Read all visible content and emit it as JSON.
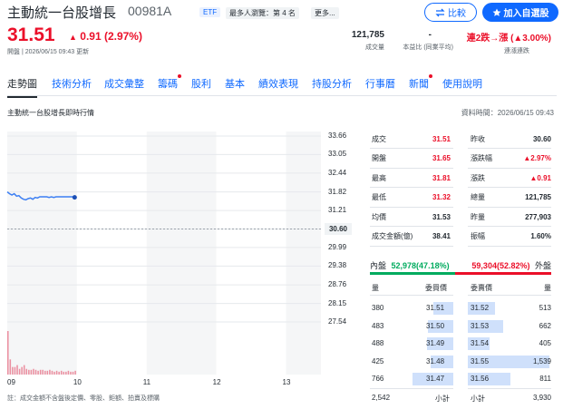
{
  "header": {
    "title": "主動統一台股增長",
    "code": "00981A",
    "etf_badge": "ETF",
    "rank_badge": "最多人瀏覽：第 4 名",
    "more_badge": "更多...",
    "compare_label": "比較",
    "watchlist_label": "加入自選股"
  },
  "quote": {
    "price": "31.51",
    "change": "0.91 (2.97%)",
    "updated": "開盤 | 2026/06/15 09:43 更新",
    "volume_value": "121,785",
    "volume_label": "成交量",
    "ratio_value": "-",
    "ratio_label": "本益比 (同業平均)",
    "streak_value": "連2跌→漲 (▲3.00%)",
    "streak_label": "連漲連跌"
  },
  "tabs": [
    {
      "label": "走勢圖",
      "dot": false
    },
    {
      "label": "技術分析",
      "dot": false
    },
    {
      "label": "成交彙整",
      "dot": false
    },
    {
      "label": "籌碼",
      "dot": true
    },
    {
      "label": "股利",
      "dot": false
    },
    {
      "label": "基本",
      "dot": false
    },
    {
      "label": "績效表現",
      "dot": false
    },
    {
      "label": "持股分析",
      "dot": false
    },
    {
      "label": "行事曆",
      "dot": false
    },
    {
      "label": "新聞",
      "dot": true
    },
    {
      "label": "使用說明",
      "dot": false
    }
  ],
  "section": {
    "title": "主動統一台股增長即時行情",
    "time": "資料時間：2026/06/15 09:43"
  },
  "chart_data": {
    "type": "line",
    "y_ticks": [
      "33.66",
      "33.05",
      "32.44",
      "31.82",
      "31.21",
      "30.60",
      "29.99",
      "29.38",
      "28.76",
      "28.15",
      "27.54"
    ],
    "x_ticks": [
      "09",
      "10",
      "11",
      "12",
      "13"
    ],
    "previous_close": "30.60",
    "ylim": [
      27.54,
      33.66
    ],
    "points": [
      {
        "t": 0,
        "y": 31.82
      },
      {
        "t": 1,
        "y": 31.76
      },
      {
        "t": 2,
        "y": 31.72
      },
      {
        "t": 3,
        "y": 31.76
      },
      {
        "t": 4,
        "y": 31.68
      },
      {
        "t": 5,
        "y": 31.7
      },
      {
        "t": 6,
        "y": 31.62
      },
      {
        "t": 7,
        "y": 31.58
      },
      {
        "t": 8,
        "y": 31.56
      },
      {
        "t": 9,
        "y": 31.6
      },
      {
        "t": 10,
        "y": 31.62
      },
      {
        "t": 11,
        "y": 31.58
      },
      {
        "t": 12,
        "y": 31.64
      },
      {
        "t": 13,
        "y": 31.62
      },
      {
        "t": 14,
        "y": 31.66
      },
      {
        "t": 15,
        "y": 31.66
      },
      {
        "t": 16,
        "y": 31.66
      },
      {
        "t": 17,
        "y": 31.66
      },
      {
        "t": 18,
        "y": 31.64
      },
      {
        "t": 19,
        "y": 31.66
      },
      {
        "t": 20,
        "y": 31.64
      },
      {
        "t": 21,
        "y": 31.66
      },
      {
        "t": 22,
        "y": 31.66
      },
      {
        "t": 23,
        "y": 31.66
      },
      {
        "t": 24,
        "y": 31.66
      },
      {
        "t": 25,
        "y": 31.66
      },
      {
        "t": 26,
        "y": 31.66
      },
      {
        "t": 27,
        "y": 31.66
      },
      {
        "t": 28,
        "y": 31.66
      },
      {
        "t": 29,
        "y": 31.64
      }
    ],
    "volumes": [
      46,
      16,
      8,
      8,
      10,
      6,
      8,
      10,
      6,
      5,
      5,
      6,
      5,
      4,
      5,
      5,
      4,
      4,
      5,
      4,
      3,
      4,
      3,
      4,
      3,
      3,
      4,
      3,
      3,
      4
    ],
    "line_color": "#3d7ff3",
    "volume_color": "#eb8fa0"
  },
  "chart_note": "註：成交金額不含盤後定價、零股、鉅額、拍賣及標購",
  "quote_table": [
    {
      "l1": "成交",
      "v1": "31.51",
      "c1": "#eb0f29",
      "l2": "昨收",
      "v2": "30.60",
      "c2": "#232a31"
    },
    {
      "l1": "開盤",
      "v1": "31.65",
      "c1": "#eb0f29",
      "l2": "漲跌幅",
      "v2": "▲2.97%",
      "c2": "#eb0f29"
    },
    {
      "l1": "最高",
      "v1": "31.81",
      "c1": "#eb0f29",
      "l2": "漲跌",
      "v2": "▲0.91",
      "c2": "#eb0f29"
    },
    {
      "l1": "最低",
      "v1": "31.32",
      "c1": "#eb0f29",
      "l2": "總量",
      "v2": "121,785",
      "c2": "#232a31"
    },
    {
      "l1": "均價",
      "v1": "31.53",
      "c1": "#232a31",
      "l2": "昨量",
      "v2": "277,903",
      "c2": "#232a31"
    },
    {
      "l1": "成交金額(億)",
      "v1": "38.41",
      "c1": "#232a31",
      "l2": "振幅",
      "v2": "1.60%",
      "c2": "#232a31"
    }
  ],
  "inout": {
    "in_label": "內盤",
    "in_value": "52,978(47.18%)",
    "in_pct": 47.18,
    "out_value": "59,304(52.82%)",
    "out_label": "外盤"
  },
  "orderbook": {
    "h_qty": "量",
    "h_bid": "委買價",
    "h_ask": "委賣價",
    "h_qty2": "量",
    "bids": [
      {
        "qty": "380",
        "price": "31.51",
        "size": 380
      },
      {
        "qty": "483",
        "price": "31.50",
        "size": 483
      },
      {
        "qty": "488",
        "price": "31.49",
        "size": 488
      },
      {
        "qty": "425",
        "price": "31.48",
        "size": 425
      },
      {
        "qty": "766",
        "price": "31.47",
        "size": 766
      }
    ],
    "asks": [
      {
        "price": "31.52",
        "qty": "513",
        "size": 513
      },
      {
        "price": "31.53",
        "qty": "662",
        "size": 662
      },
      {
        "price": "31.54",
        "qty": "405",
        "size": 405
      },
      {
        "price": "31.55",
        "qty": "1,539",
        "size": 1539
      },
      {
        "price": "31.56",
        "qty": "811",
        "size": 811
      }
    ],
    "bid_total": "2,542",
    "bid_total_label": "小計",
    "ask_total_label": "小計",
    "ask_total": "3,930"
  }
}
